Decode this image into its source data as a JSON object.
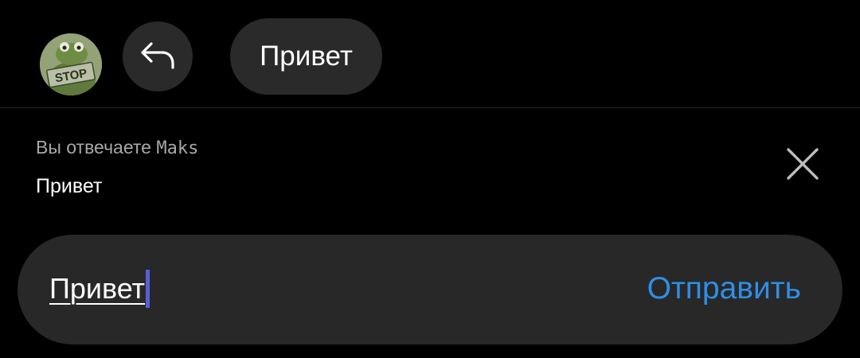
{
  "header": {
    "avatar_sign_text": "STOP",
    "reply_icon": "reply-arrow-icon",
    "quick_reply_label": "Привет"
  },
  "reply_preview": {
    "caption": "Вы отвечаете",
    "recipient": "Maks",
    "quoted_text": "Привет",
    "close_icon": "close-icon"
  },
  "composer": {
    "input_value": "Привет",
    "send_label": "Отправить"
  },
  "colors": {
    "background": "#000000",
    "surface": "#282828",
    "accent": "#2e8fe6",
    "caret": "#5a5cdc",
    "secondary_text": "#a8a8a8"
  }
}
